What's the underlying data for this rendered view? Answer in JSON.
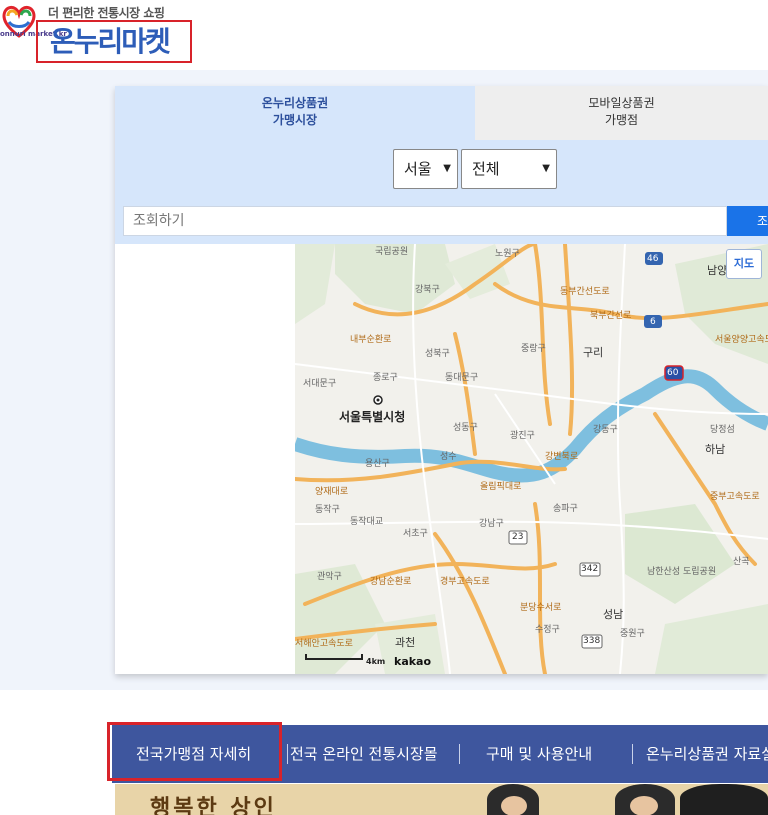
{
  "header": {
    "tagline": "더 편리한 전통시장 쇼핑",
    "logo_brand": "onnuri market.kr",
    "logo_title": "온누리마켓"
  },
  "search": {
    "tabs": [
      {
        "line1": "온누리상품권",
        "line2": "가맹시장",
        "active": true
      },
      {
        "line1": "모바일상품권",
        "line2": "가맹점",
        "active": false
      }
    ],
    "region_select": "서울",
    "district_select": "전체",
    "placeholder": "조회하기",
    "search_button_label": "조회"
  },
  "map": {
    "type_button": "지도",
    "scale_label": "4km",
    "credit": "kakao",
    "labels": [
      "국립공원",
      "노원구",
      "강북구",
      "성북구",
      "중랑구",
      "구리",
      "남양주",
      "종로구",
      "동대문구",
      "서대문구",
      "서울특별시청",
      "광진구",
      "강동구",
      "성동구",
      "하남",
      "당정섬",
      "용산구",
      "성수",
      "동작구",
      "동작대교",
      "서초구",
      "강남구",
      "송파구",
      "남한산성 도립공원",
      "관악구",
      "과천",
      "수정구",
      "중원구",
      "성남",
      "산곡"
    ],
    "route_numbers": [
      "46",
      "6",
      "60",
      "23",
      "342",
      "338"
    ],
    "road_labels": [
      "내부순환로",
      "북부간선로",
      "서울양양고속도로",
      "올림픽대로",
      "강변북로",
      "동부간선도로",
      "경부고속도로",
      "강남순환로",
      "분당수서로",
      "중부고속도로",
      "양재대로",
      "서해안고속도로"
    ]
  },
  "nav": {
    "items": [
      "전국가맹점 자세히",
      "전국 온라인 전통시장몰",
      "구매 및 사용안내",
      "온누리상품권 자료실"
    ]
  },
  "banner": {
    "text": "행복한 상인"
  }
}
